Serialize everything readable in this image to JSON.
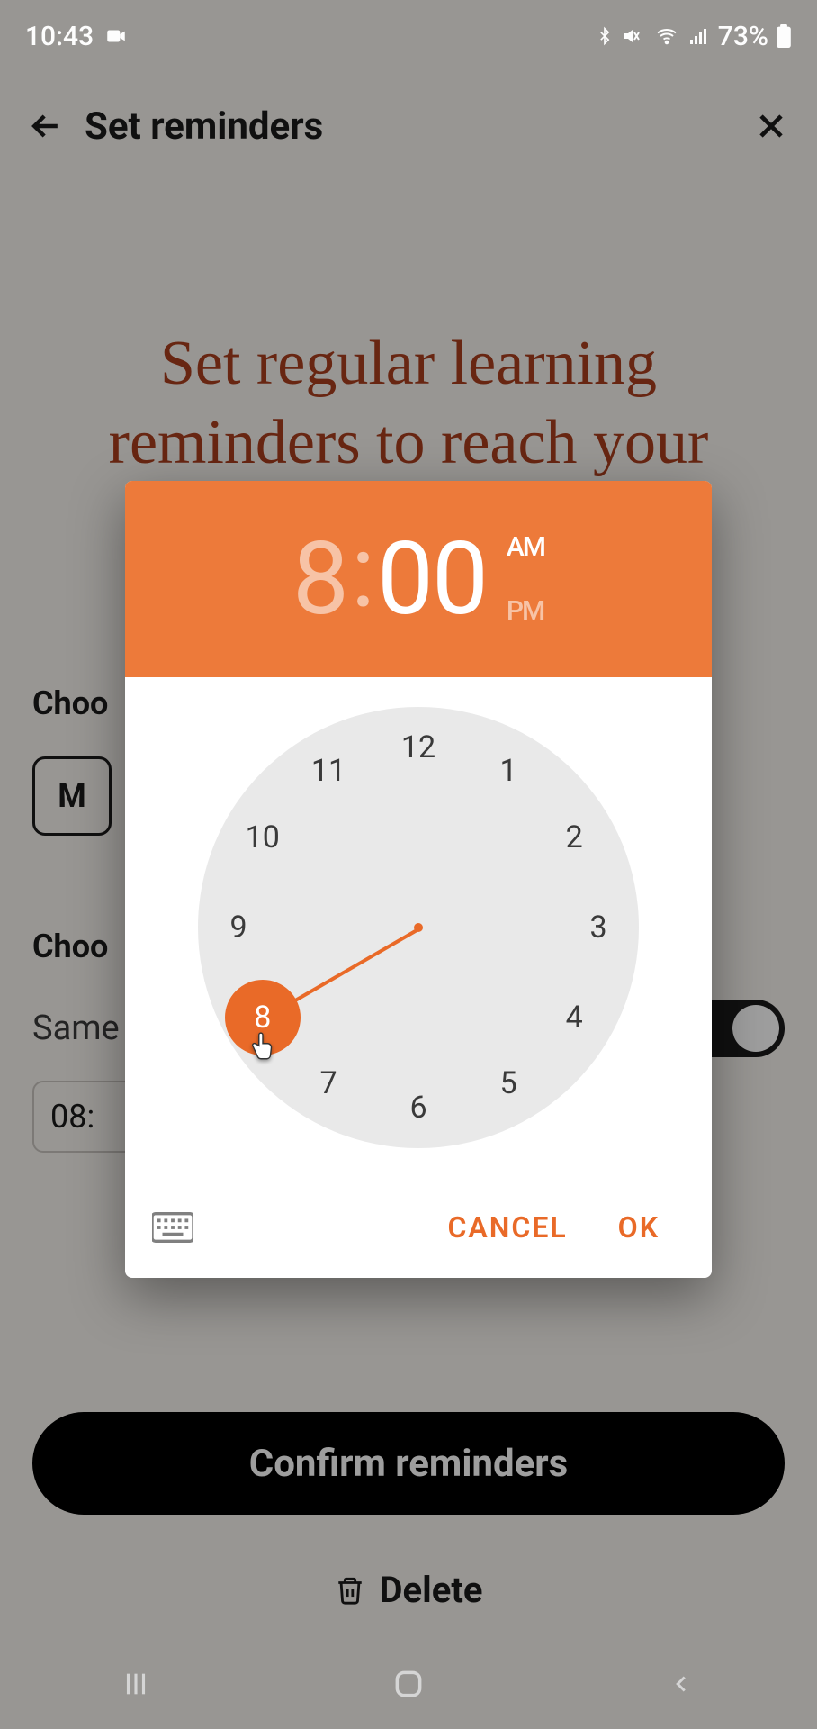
{
  "status": {
    "time": "10:43",
    "battery": "73%"
  },
  "header": {
    "title": "Set reminders"
  },
  "heading": "Set regular learning reminders to reach your",
  "choose_days_label_visible": "Choo",
  "day_chip": "M",
  "choose_times_label_visible": "Choo",
  "same_label_visible": "Same",
  "time_field_visible": "08:",
  "confirm_label": "Confirm reminders",
  "delete_label": "Delete",
  "picker": {
    "hour": "8",
    "minute": "00",
    "am": "AM",
    "pm": "PM",
    "selected_hour": 8,
    "numbers": [
      "12",
      "1",
      "2",
      "3",
      "4",
      "5",
      "6",
      "7",
      "8",
      "9",
      "10",
      "11"
    ],
    "cancel": "CANCEL",
    "ok": "OK"
  }
}
